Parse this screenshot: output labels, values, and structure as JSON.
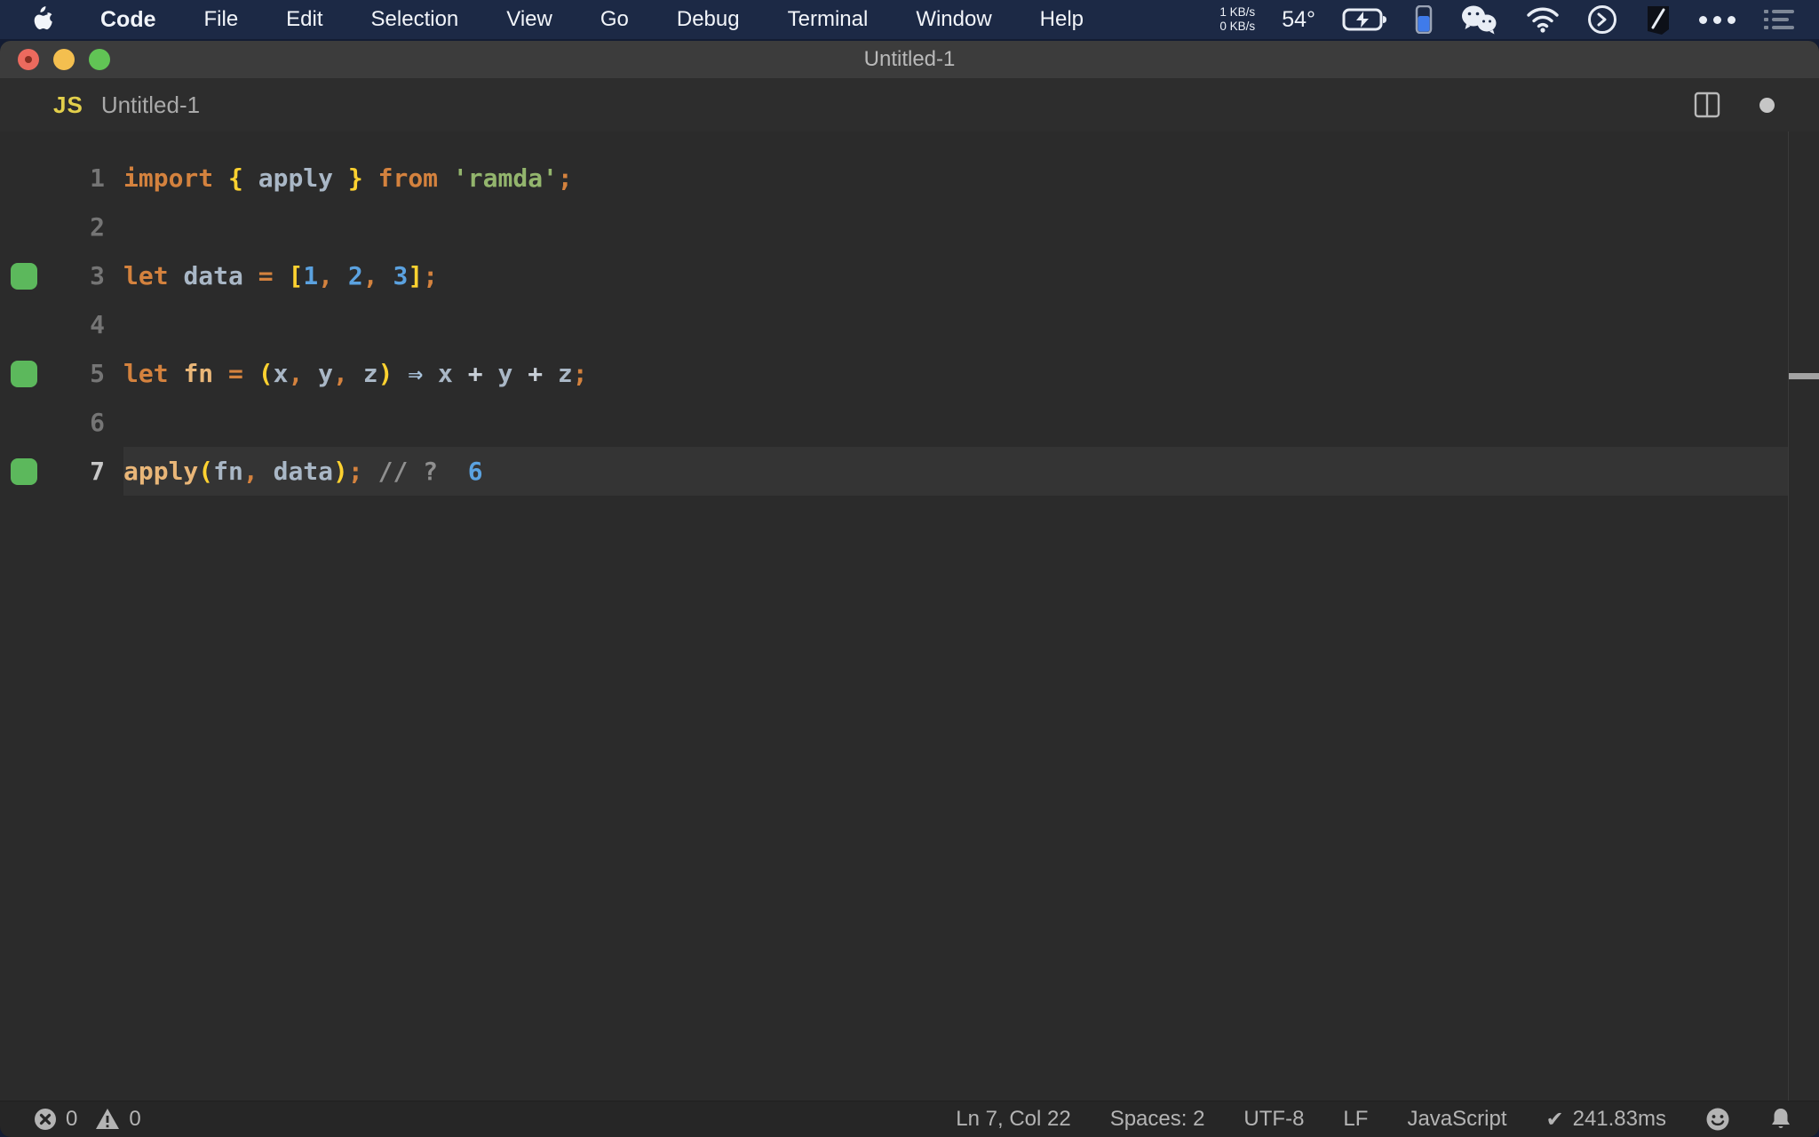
{
  "menubar": {
    "items": [
      "Code",
      "File",
      "Edit",
      "Selection",
      "View",
      "Go",
      "Debug",
      "Terminal",
      "Window",
      "Help"
    ],
    "status": {
      "net_up": "1 KB/s",
      "net_down": "0 KB/s",
      "temperature": "54°"
    }
  },
  "window": {
    "title": "Untitled-1",
    "tab": {
      "file_type": "JS",
      "label": "Untitled-1"
    }
  },
  "editor": {
    "marker_color": "#5cb85c",
    "token_colors": {
      "kw": "#d4823e",
      "fn": "#e9b678",
      "id": "#a9b7c6",
      "br": "#ffd230",
      "pn": "#d4823e",
      "num": "#5ba2e0",
      "str": "#93b56d",
      "cm": "#8f8f8f",
      "op": "#c7ced6",
      "ar": "#a9c3dc",
      "pl": "#a9b7c6"
    },
    "active_line": "7",
    "lines": [
      {
        "num": "1",
        "marker": false,
        "tokens": [
          [
            "kw",
            "import"
          ],
          [
            "pl",
            " "
          ],
          [
            "br",
            "{"
          ],
          [
            "id",
            " apply "
          ],
          [
            "br",
            "}"
          ],
          [
            "pl",
            " "
          ],
          [
            "kw",
            "from"
          ],
          [
            "pl",
            " "
          ],
          [
            "str",
            "'ramda'"
          ],
          [
            "pn",
            ";"
          ]
        ]
      },
      {
        "num": "2",
        "marker": false,
        "tokens": []
      },
      {
        "num": "3",
        "marker": true,
        "tokens": [
          [
            "kw",
            "let"
          ],
          [
            "pl",
            " "
          ],
          [
            "id",
            "data"
          ],
          [
            "pl",
            " "
          ],
          [
            "pn",
            "="
          ],
          [
            "pl",
            " "
          ],
          [
            "br",
            "["
          ],
          [
            "num",
            "1"
          ],
          [
            "pn",
            ","
          ],
          [
            "pl",
            " "
          ],
          [
            "num",
            "2"
          ],
          [
            "pn",
            ","
          ],
          [
            "pl",
            " "
          ],
          [
            "num",
            "3"
          ],
          [
            "br",
            "]"
          ],
          [
            "pn",
            ";"
          ]
        ]
      },
      {
        "num": "4",
        "marker": false,
        "tokens": []
      },
      {
        "num": "5",
        "marker": true,
        "tokens": [
          [
            "kw",
            "let"
          ],
          [
            "pl",
            " "
          ],
          [
            "fn",
            "fn"
          ],
          [
            "pl",
            " "
          ],
          [
            "pn",
            "="
          ],
          [
            "pl",
            " "
          ],
          [
            "br",
            "("
          ],
          [
            "id",
            "x"
          ],
          [
            "pn",
            ","
          ],
          [
            "pl",
            " "
          ],
          [
            "id",
            "y"
          ],
          [
            "pn",
            ","
          ],
          [
            "pl",
            " "
          ],
          [
            "id",
            "z"
          ],
          [
            "br",
            ")"
          ],
          [
            "pl",
            " "
          ],
          [
            "ar",
            "⇒"
          ],
          [
            "pl",
            " "
          ],
          [
            "id",
            "x"
          ],
          [
            "pl",
            " "
          ],
          [
            "op",
            "+"
          ],
          [
            "pl",
            " "
          ],
          [
            "id",
            "y"
          ],
          [
            "pl",
            " "
          ],
          [
            "op",
            "+"
          ],
          [
            "pl",
            " "
          ],
          [
            "id",
            "z"
          ],
          [
            "pn",
            ";"
          ]
        ]
      },
      {
        "num": "6",
        "marker": false,
        "tokens": []
      },
      {
        "num": "7",
        "marker": true,
        "active": true,
        "tokens": [
          [
            "fn",
            "apply"
          ],
          [
            "br",
            "("
          ],
          [
            "id",
            "fn"
          ],
          [
            "pn",
            ","
          ],
          [
            "pl",
            " "
          ],
          [
            "id",
            "data"
          ],
          [
            "br",
            ")"
          ],
          [
            "pn",
            ";"
          ],
          [
            "pl",
            " "
          ],
          [
            "cm",
            "// ?"
          ],
          [
            "pl",
            "  "
          ],
          [
            "num",
            "6"
          ]
        ]
      }
    ]
  },
  "statusbar": {
    "errors": "0",
    "warnings": "0",
    "cursor": "Ln 7, Col 22",
    "indent": "Spaces: 2",
    "encoding": "UTF-8",
    "eol": "LF",
    "language": "JavaScript",
    "timing_check": "✔",
    "timing": "241.83ms"
  }
}
